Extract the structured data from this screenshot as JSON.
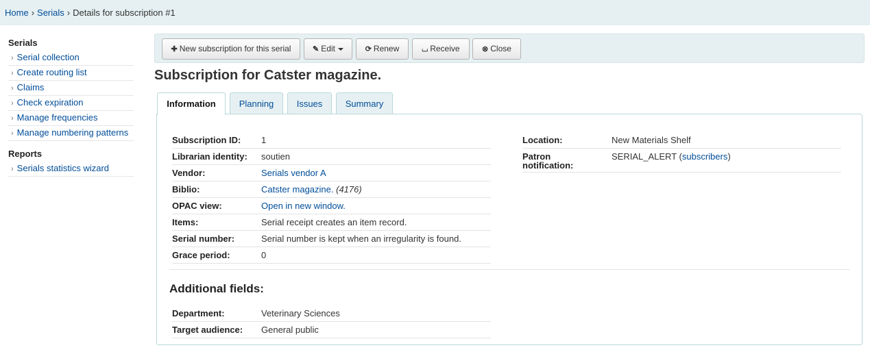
{
  "breadcrumb": {
    "home": "Home",
    "serials": "Serials",
    "current": "Details for subscription #1"
  },
  "sidebar": {
    "serials_heading": "Serials",
    "serials_items": [
      "Serial collection",
      "Create routing list",
      "Claims",
      "Check expiration",
      "Manage frequencies",
      "Manage numbering patterns"
    ],
    "reports_heading": "Reports",
    "reports_items": [
      "Serials statistics wizard"
    ]
  },
  "toolbar": {
    "new_subscription": "New subscription for this serial",
    "edit": "Edit",
    "renew": "Renew",
    "receive": "Receive",
    "close": "Close"
  },
  "page_title": "Subscription for Catster magazine.",
  "tabs": [
    "Information",
    "Planning",
    "Issues",
    "Summary"
  ],
  "info_left": {
    "subscription_id_label": "Subscription ID:",
    "subscription_id": "1",
    "librarian_label": "Librarian identity:",
    "librarian": "soutien",
    "vendor_label": "Vendor:",
    "vendor": "Serials vendor A",
    "biblio_label": "Biblio:",
    "biblio_title": "Catster magazine.",
    "biblio_number": "(4176)",
    "opac_label": "OPAC view:",
    "opac": "Open in new window.",
    "items_label": "Items:",
    "items": "Serial receipt creates an item record.",
    "serial_number_label": "Serial number:",
    "serial_number": "Serial number is kept when an irregularity is found.",
    "grace_label": "Grace period:",
    "grace": "0"
  },
  "info_right": {
    "location_label": "Location:",
    "location": "New Materials Shelf",
    "patron_label_1": "Patron",
    "patron_label_2": "notification:",
    "patron_value": "SERIAL_ALERT",
    "patron_open": " (",
    "subscribers_link": "subscribers",
    "patron_close": ")"
  },
  "additional": {
    "heading": "Additional fields:",
    "department_label": "Department:",
    "department": "Veterinary Sciences",
    "audience_label": "Target audience:",
    "audience": "General public"
  },
  "colors": {
    "link": "#004d99",
    "breadcrumb_bg": "#e6f0f2",
    "tab_border": "#b9d8d9"
  }
}
